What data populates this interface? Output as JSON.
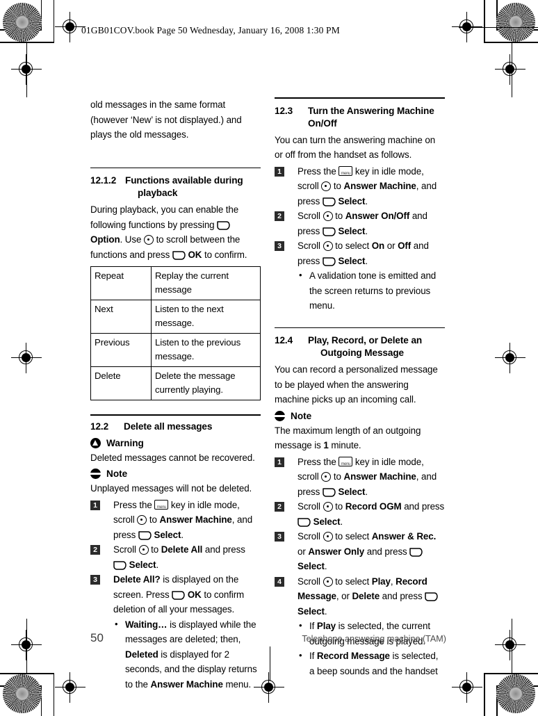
{
  "header": {
    "text": "01GB01COV.book  Page 50  Wednesday, January 16, 2008  1:30 PM"
  },
  "footer": {
    "page_number": "50",
    "caption": "Telephone answering machine (TAM)"
  },
  "icons": {
    "menu_key": "menu-key-icon",
    "nav_key": "navigation-key-icon",
    "soft_key": "soft-key-icon",
    "warning": "warning-icon",
    "note": "note-icon"
  },
  "left_column": {
    "intro_paragraph": {
      "line1": "old messages in the same format",
      "line2": "(however ‘New’ is not displayed.)",
      "line3": "and plays the old messages."
    },
    "section_12_1_2": {
      "number": "12.1.2",
      "title_line1": "Functions available during",
      "title_line2": "playback",
      "para_a": "During playback, you can enable the",
      "para_b": "following functions by pressing",
      "para_c_bold": "Option",
      "para_d": ". Use",
      "para_e": "to scroll between the",
      "para_f": "functions and press",
      "para_g_bold": "OK",
      "para_h": "to confirm.",
      "table": {
        "rows": [
          {
            "key": "Repeat",
            "desc": "Replay the current message"
          },
          {
            "key": "Next",
            "desc": "Listen to the next message."
          },
          {
            "key": "Previous",
            "desc": "Listen to the previous message."
          },
          {
            "key": "Delete",
            "desc": "Delete the message currently playing."
          }
        ]
      }
    },
    "section_12_2": {
      "number": "12.2",
      "title": "Delete all messages",
      "warning_label": "Warning",
      "warning_text": "Deleted messages cannot be recovered.",
      "note_label": "Note",
      "note_text": "Unplayed messages will not be deleted.",
      "steps": [
        {
          "num": "1",
          "t1": "Press the",
          "t2": "key in idle mode, scroll",
          "t3": "to",
          "b1": "Answer Machine",
          "t4": ", and press",
          "b2": "Select",
          "t5": "."
        },
        {
          "num": "2",
          "t1": "Scroll",
          "t2": "to",
          "b1": "Delete All",
          "t3": "and press",
          "b2": "Select",
          "t4": "."
        },
        {
          "num": "3",
          "b1": "Delete All?",
          "t1": "is displayed on the screen. Press",
          "b2": "OK",
          "t2": "to confirm deletion of all your messages.",
          "bullets": [
            {
              "b1": "Waiting…",
              "t1": "is displayed while the messages are deleted; then,",
              "b2": "Deleted",
              "t2": "is displayed for 2 seconds, and the display returns to the",
              "b3": "Answer Machine",
              "t3": "menu."
            }
          ]
        }
      ]
    }
  },
  "right_column": {
    "section_12_3": {
      "number": "12.3",
      "title_line1": "Turn the Answering Machine",
      "title_line2": "On/Off",
      "para": "You can turn the answering machine on or off from the handset as follows.",
      "steps": [
        {
          "num": "1",
          "t1": "Press the",
          "t2": "key in idle mode, scroll",
          "t3": "to",
          "b1": "Answer Machine",
          "t4": ", and press",
          "b2": "Select",
          "t5": "."
        },
        {
          "num": "2",
          "t1": "Scroll",
          "t2": "to",
          "b1": "Answer On/Off",
          "t3": "and press",
          "b2": "Select",
          "t4": "."
        },
        {
          "num": "3",
          "t1": "Scroll",
          "t2": "to select",
          "b1": "On",
          "t3": "or",
          "b2": "Off",
          "t4": "and press",
          "b3": "Select",
          "t5": ".",
          "bullets": [
            {
              "t1": "A validation tone is emitted and the screen returns to previous menu."
            }
          ]
        }
      ]
    },
    "section_12_4": {
      "number": "12.4",
      "title_line1": "Play, Record, or Delete an",
      "title_line2": "Outgoing Message",
      "para": "You can record a personalized message to be played when the answering machine picks up an incoming call.",
      "note_label": "Note",
      "note_text_a": "The maximum length of an outgoing message is",
      "note_text_b": "1",
      "note_text_c": "minute.",
      "steps": [
        {
          "num": "1",
          "t1": "Press the",
          "t2": "key in idle mode, scroll",
          "t3": "to",
          "b1": "Answer Machine",
          "t4": ", and press",
          "b2": "Select",
          "t5": "."
        },
        {
          "num": "2",
          "t1": "Scroll",
          "t2": "to",
          "b1": "Record OGM",
          "t3": "and press",
          "b2": "Select",
          "t4": "."
        },
        {
          "num": "3",
          "t1": "Scroll",
          "t2": "to select",
          "b1": "Answer & Rec.",
          "t3": "or",
          "b2": "Answer Only",
          "t4": "and press",
          "b3": "Select",
          "t5": "."
        },
        {
          "num": "4",
          "t1": "Scroll",
          "t2": "to select",
          "b1": "Play",
          "t3": ",",
          "b2": "Record Message",
          "t4": ", or",
          "b3": "Delete",
          "t5": "and press",
          "b4": "Select",
          "t6": ".",
          "bullets": [
            {
              "t1": "If",
              "b1": "Play",
              "t2": "is selected, the current outgoing message is played."
            },
            {
              "t1": "If",
              "b1": "Record Message",
              "t2": "is selected, a beep sounds and the handset"
            }
          ]
        }
      ]
    }
  }
}
